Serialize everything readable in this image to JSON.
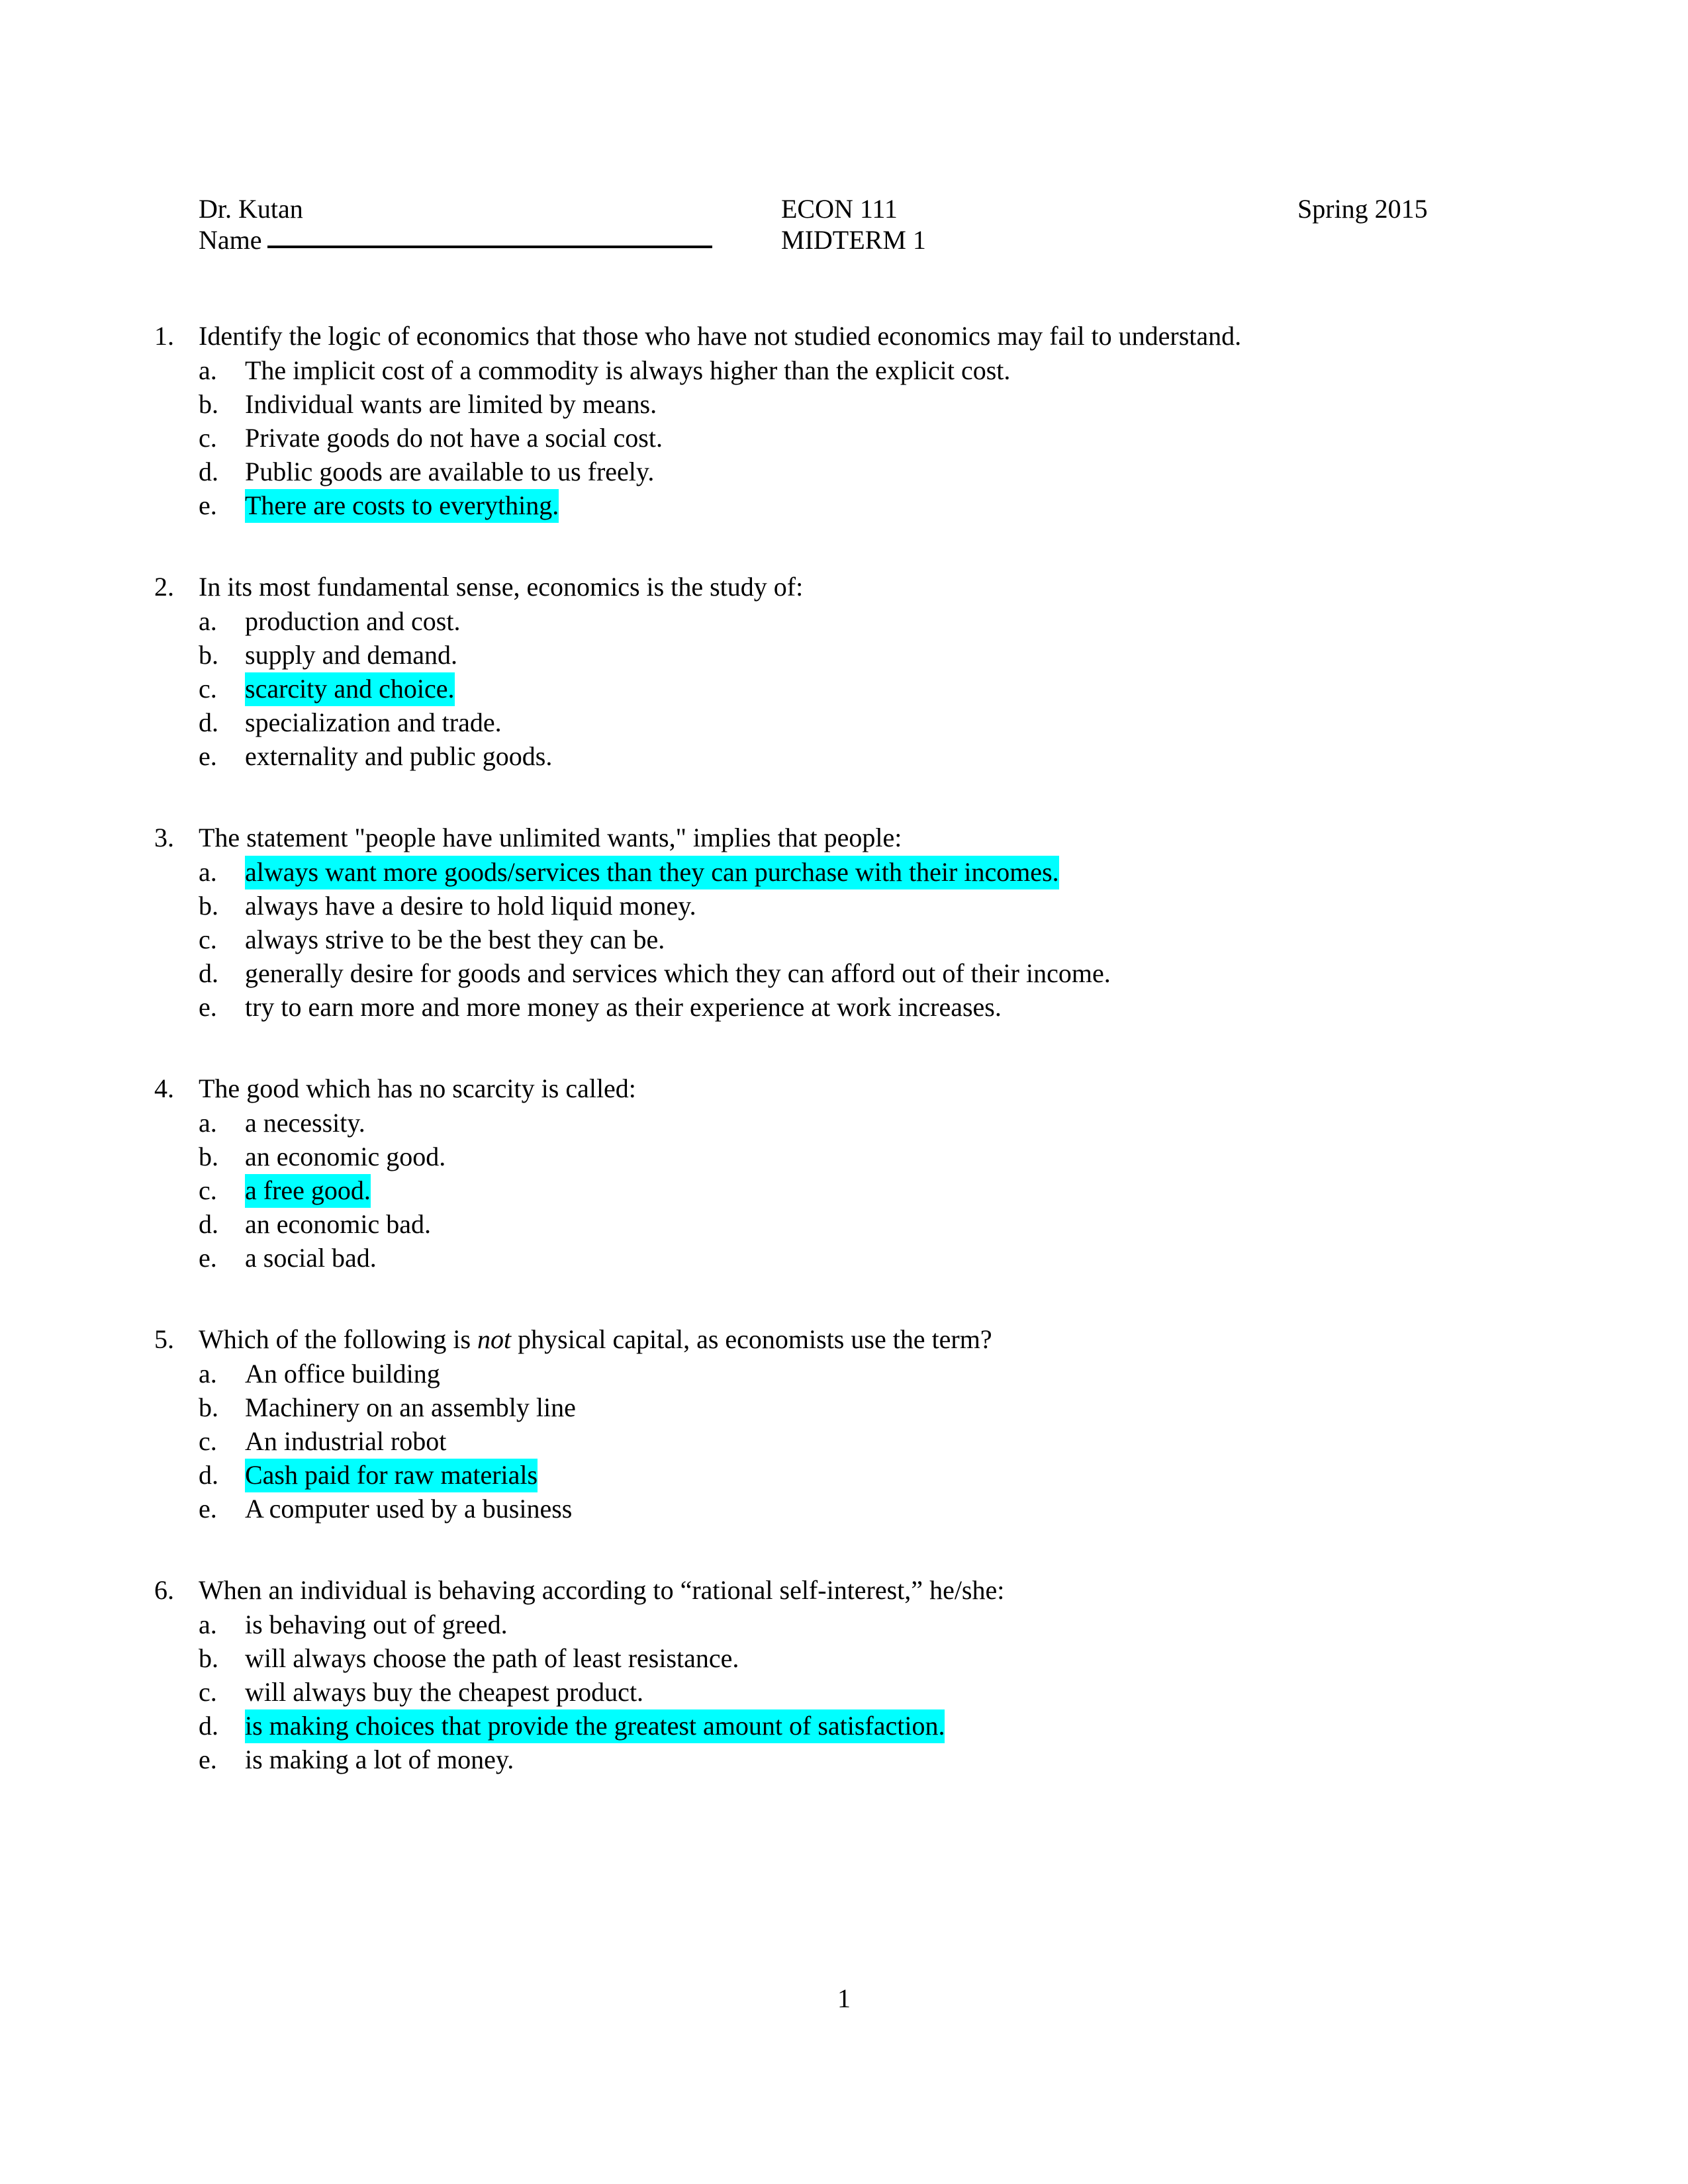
{
  "document": {
    "page_number": "1"
  },
  "header": {
    "instructor": "Dr. Kutan",
    "name_label": "Name",
    "course": "ECON 111",
    "exam": "MIDTERM 1",
    "term": "Spring 2015"
  },
  "highlight_color": "#00FFFF",
  "questions": [
    {
      "number": "1.",
      "text": "Identify the logic of economics that those who have not studied economics may fail to understand.",
      "options": [
        {
          "letter": "a.",
          "text": "The implicit cost of a commodity is always higher than the explicit cost.",
          "highlighted": false
        },
        {
          "letter": "b.",
          "text": "Individual wants are limited by means.",
          "highlighted": false
        },
        {
          "letter": "c.",
          "text": "Private goods do not have a social cost.",
          "highlighted": false
        },
        {
          "letter": "d.",
          "text": "Public goods are available to us freely.",
          "highlighted": false
        },
        {
          "letter": "e.",
          "text": "There are costs to everything.",
          "highlighted": true
        }
      ]
    },
    {
      "number": "2.",
      "text": "In its most fundamental sense, economics is the study of:",
      "options": [
        {
          "letter": "a.",
          "text": "production and cost.",
          "highlighted": false
        },
        {
          "letter": "b.",
          "text": "supply and demand.",
          "highlighted": false
        },
        {
          "letter": "c.",
          "text": "scarcity and choice.",
          "highlighted": true
        },
        {
          "letter": "d.",
          "text": "specialization and trade.",
          "highlighted": false
        },
        {
          "letter": "e.",
          "text": "externality and public goods.",
          "highlighted": false
        }
      ]
    },
    {
      "number": "3.",
      "text": "The statement \"people have unlimited wants,\" implies that people:",
      "options": [
        {
          "letter": "a.",
          "text": "always want more goods/services than they can purchase with their incomes.",
          "highlighted": true
        },
        {
          "letter": "b.",
          "text": "always have a desire to hold liquid money.",
          "highlighted": false
        },
        {
          "letter": "c.",
          "text": "always strive to be the best they can be.",
          "highlighted": false
        },
        {
          "letter": "d.",
          "text": "generally desire for goods and services which they can afford out of their income.",
          "highlighted": false
        },
        {
          "letter": "e.",
          "text": "try to earn more and more money as their experience at work increases.",
          "highlighted": false
        }
      ]
    },
    {
      "number": "4.",
      "text": "The good which has no scarcity is called:",
      "options": [
        {
          "letter": "a.",
          "text": "a necessity.",
          "highlighted": false
        },
        {
          "letter": "b.",
          "text": "an economic good.",
          "highlighted": false
        },
        {
          "letter": "c.",
          "text": "a free good.",
          "highlighted": true
        },
        {
          "letter": "d.",
          "text": "an economic bad.",
          "highlighted": false
        },
        {
          "letter": "e.",
          "text": "a social bad.",
          "highlighted": false
        }
      ]
    },
    {
      "number": "5.",
      "text_parts": [
        {
          "text": "Which of the following is ",
          "italic": false
        },
        {
          "text": "not",
          "italic": true
        },
        {
          "text": " physical capital, as economists use the term?",
          "italic": false
        }
      ],
      "text": "Which of the following is not physical capital, as economists use the term?",
      "options": [
        {
          "letter": "a.",
          "text": "An office building",
          "highlighted": false
        },
        {
          "letter": "b.",
          "text": "Machinery on an assembly line",
          "highlighted": false
        },
        {
          "letter": "c.",
          "text": "An industrial robot",
          "highlighted": false
        },
        {
          "letter": "d.",
          "text": "Cash paid for raw materials",
          "highlighted": true
        },
        {
          "letter": "e.",
          "text": "A computer used by a business",
          "highlighted": false
        }
      ]
    },
    {
      "number": "6.",
      "text": "When an individual is behaving according to “rational self-interest,” he/she:",
      "options": [
        {
          "letter": "a.",
          "text": "is behaving out of greed.",
          "highlighted": false
        },
        {
          "letter": "b.",
          "text": "will always choose the path of least resistance.",
          "highlighted": false
        },
        {
          "letter": "c.",
          "text": "will always buy the cheapest product.",
          "highlighted": false
        },
        {
          "letter": "d.",
          "text": "is making choices that provide the greatest amount of satisfaction.",
          "highlighted": true
        },
        {
          "letter": "e.",
          "text": "is making a lot of money.",
          "highlighted": false
        }
      ]
    }
  ]
}
